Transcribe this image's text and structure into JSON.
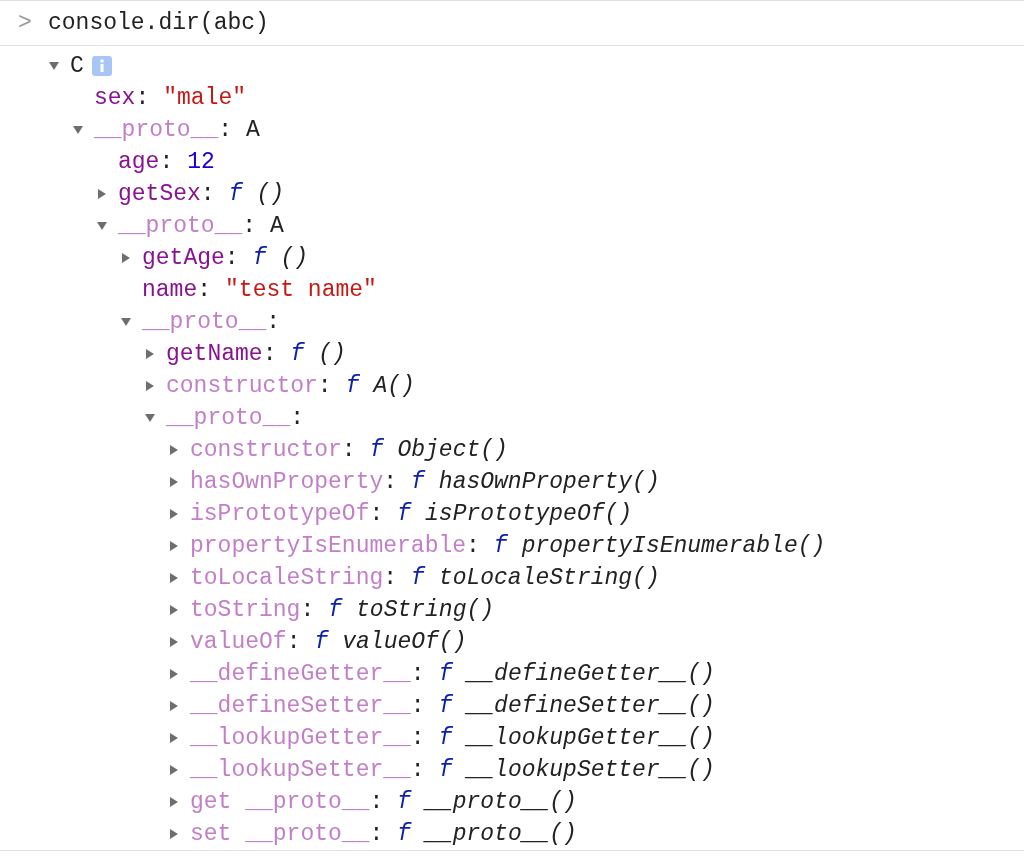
{
  "prompt": {
    "marker": ">",
    "command": "console.dir(abc)"
  },
  "tree": {
    "label": "C",
    "expanded": true,
    "info": true,
    "children": [
      {
        "key": "sex",
        "sep": ":",
        "own": true,
        "kind": "leaf",
        "value": {
          "kind": "string",
          "text": "\"male\""
        }
      },
      {
        "key": "__proto__",
        "sep": ":",
        "own": false,
        "kind": "expandable",
        "expanded": true,
        "value": {
          "kind": "class",
          "text": "A"
        },
        "children": [
          {
            "key": "age",
            "sep": ":",
            "own": true,
            "kind": "leaf",
            "value": {
              "kind": "number",
              "text": "12"
            }
          },
          {
            "key": "getSex",
            "sep": ":",
            "own": true,
            "kind": "expandable",
            "expanded": false,
            "value": {
              "kind": "function",
              "marker": "f",
              "text": "()"
            }
          },
          {
            "key": "__proto__",
            "sep": ":",
            "own": false,
            "kind": "expandable",
            "expanded": true,
            "value": {
              "kind": "class",
              "text": "A"
            },
            "children": [
              {
                "key": "getAge",
                "sep": ":",
                "own": true,
                "kind": "expandable",
                "expanded": false,
                "value": {
                  "kind": "function",
                  "marker": "f",
                  "text": "()"
                }
              },
              {
                "key": "name",
                "sep": ":",
                "own": true,
                "kind": "leaf",
                "value": {
                  "kind": "string",
                  "text": "\"test name\""
                }
              },
              {
                "key": "__proto__",
                "sep": ":",
                "own": false,
                "kind": "expandable",
                "expanded": true,
                "children": [
                  {
                    "key": "getName",
                    "sep": ":",
                    "own": true,
                    "kind": "expandable",
                    "expanded": false,
                    "value": {
                      "kind": "function",
                      "marker": "f",
                      "text": "()"
                    }
                  },
                  {
                    "key": "constructor",
                    "sep": ":",
                    "own": false,
                    "kind": "expandable",
                    "expanded": false,
                    "value": {
                      "kind": "function",
                      "marker": "f",
                      "text": "A()"
                    }
                  },
                  {
                    "key": "__proto__",
                    "sep": ":",
                    "own": false,
                    "kind": "expandable",
                    "expanded": true,
                    "children": [
                      {
                        "key": "constructor",
                        "sep": ":",
                        "own": false,
                        "kind": "expandable",
                        "expanded": false,
                        "value": {
                          "kind": "function",
                          "marker": "f",
                          "text": "Object()"
                        }
                      },
                      {
                        "key": "hasOwnProperty",
                        "sep": ":",
                        "own": false,
                        "kind": "expandable",
                        "expanded": false,
                        "value": {
                          "kind": "function",
                          "marker": "f",
                          "text": "hasOwnProperty()"
                        }
                      },
                      {
                        "key": "isPrototypeOf",
                        "sep": ":",
                        "own": false,
                        "kind": "expandable",
                        "expanded": false,
                        "value": {
                          "kind": "function",
                          "marker": "f",
                          "text": "isPrototypeOf()"
                        }
                      },
                      {
                        "key": "propertyIsEnumerable",
                        "sep": ":",
                        "own": false,
                        "kind": "expandable",
                        "expanded": false,
                        "value": {
                          "kind": "function",
                          "marker": "f",
                          "text": "propertyIsEnumerable()"
                        }
                      },
                      {
                        "key": "toLocaleString",
                        "sep": ":",
                        "own": false,
                        "kind": "expandable",
                        "expanded": false,
                        "value": {
                          "kind": "function",
                          "marker": "f",
                          "text": "toLocaleString()"
                        }
                      },
                      {
                        "key": "toString",
                        "sep": ":",
                        "own": false,
                        "kind": "expandable",
                        "expanded": false,
                        "value": {
                          "kind": "function",
                          "marker": "f",
                          "text": "toString()"
                        }
                      },
                      {
                        "key": "valueOf",
                        "sep": ":",
                        "own": false,
                        "kind": "expandable",
                        "expanded": false,
                        "value": {
                          "kind": "function",
                          "marker": "f",
                          "text": "valueOf()"
                        }
                      },
                      {
                        "key": "__defineGetter__",
                        "sep": ":",
                        "own": false,
                        "kind": "expandable",
                        "expanded": false,
                        "value": {
                          "kind": "function",
                          "marker": "f",
                          "text": "__defineGetter__()"
                        }
                      },
                      {
                        "key": "__defineSetter__",
                        "sep": ":",
                        "own": false,
                        "kind": "expandable",
                        "expanded": false,
                        "value": {
                          "kind": "function",
                          "marker": "f",
                          "text": "__defineSetter__()"
                        }
                      },
                      {
                        "key": "__lookupGetter__",
                        "sep": ":",
                        "own": false,
                        "kind": "expandable",
                        "expanded": false,
                        "value": {
                          "kind": "function",
                          "marker": "f",
                          "text": "__lookupGetter__()"
                        }
                      },
                      {
                        "key": "__lookupSetter__",
                        "sep": ":",
                        "own": false,
                        "kind": "expandable",
                        "expanded": false,
                        "value": {
                          "kind": "function",
                          "marker": "f",
                          "text": "__lookupSetter__()"
                        }
                      },
                      {
                        "key": "get __proto__",
                        "sep": ":",
                        "own": false,
                        "kind": "expandable",
                        "expanded": false,
                        "value": {
                          "kind": "function",
                          "marker": "f",
                          "text": "__proto__()"
                        }
                      },
                      {
                        "key": "set __proto__",
                        "sep": ":",
                        "own": false,
                        "kind": "expandable",
                        "expanded": false,
                        "value": {
                          "kind": "function",
                          "marker": "f",
                          "text": "__proto__()"
                        }
                      }
                    ]
                  }
                ]
              }
            ]
          }
        ]
      }
    ]
  }
}
